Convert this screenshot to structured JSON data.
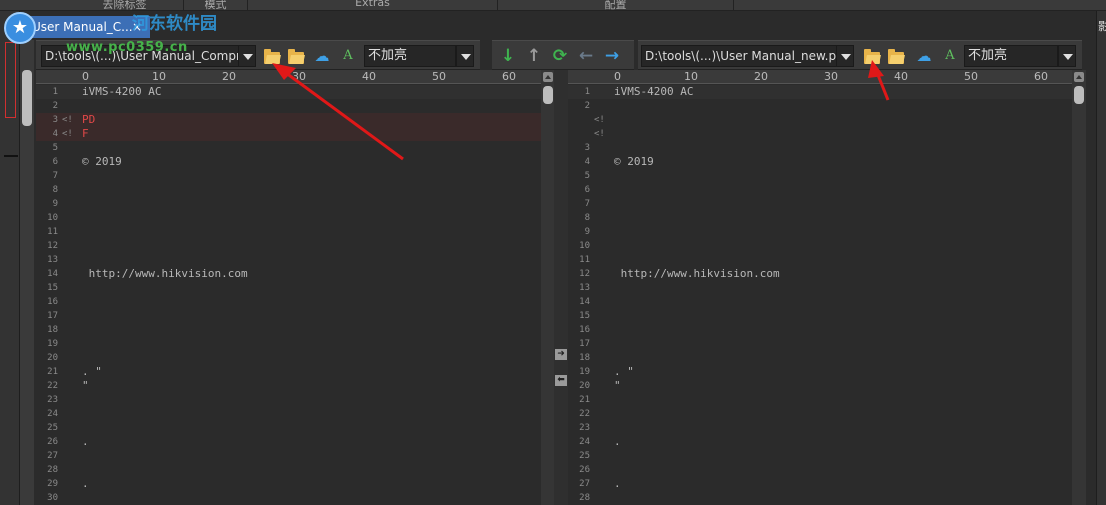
{
  "ribbon": {
    "tabs": [
      "去除标签",
      "模式",
      "Extras",
      "配置"
    ]
  },
  "watermark": {
    "site": "www.pc0359.cn",
    "name": "河东软件园"
  },
  "document_tab": {
    "title": "User Manual_C...",
    "close_glyph": "×"
  },
  "left_toolbar": {
    "path": "D:\\tools\\(...)\\User Manual_Compr",
    "encoding": "不加亮"
  },
  "right_toolbar": {
    "path": "D:\\tools\\(...)\\User Manual_new.pd",
    "encoding": "不加亮"
  },
  "icons": {
    "open_folder": "open-folder-icon",
    "recent_folder": "recent-folder-icon",
    "reload": "reload-icon",
    "cloud": "cloud-icon",
    "font": "A",
    "next_diff": "↓",
    "prev_diff": "↑",
    "sync": "⟳",
    "copy_left": "←",
    "copy_right": "→"
  },
  "ruler": {
    "labels": [
      "0",
      "10",
      "20",
      "30",
      "40",
      "50",
      "60"
    ]
  },
  "left_pane": {
    "lines": [
      {
        "num": "1",
        "mark": "",
        "text": "iVMS-4200 AC",
        "type": "first"
      },
      {
        "num": "2",
        "mark": "",
        "text": "",
        "type": ""
      },
      {
        "num": "3",
        "mark": "<!",
        "text": "PD",
        "type": "removed"
      },
      {
        "num": "4",
        "mark": "<!",
        "text": "F",
        "type": "removed"
      },
      {
        "num": "5",
        "mark": "",
        "text": "",
        "type": ""
      },
      {
        "num": "6",
        "mark": "",
        "text": "© 2019",
        "type": ""
      },
      {
        "num": "7",
        "mark": "",
        "text": "",
        "type": ""
      },
      {
        "num": "8",
        "mark": "",
        "text": "",
        "type": ""
      },
      {
        "num": "9",
        "mark": "",
        "text": "",
        "type": ""
      },
      {
        "num": "10",
        "mark": "",
        "text": "",
        "type": ""
      },
      {
        "num": "11",
        "mark": "",
        "text": "",
        "type": ""
      },
      {
        "num": "12",
        "mark": "",
        "text": "",
        "type": ""
      },
      {
        "num": "13",
        "mark": "",
        "text": "",
        "type": ""
      },
      {
        "num": "14",
        "mark": "",
        "text": " http://www.hikvision.com",
        "type": ""
      },
      {
        "num": "15",
        "mark": "",
        "text": "",
        "type": ""
      },
      {
        "num": "16",
        "mark": "",
        "text": "",
        "type": ""
      },
      {
        "num": "17",
        "mark": "",
        "text": "",
        "type": ""
      },
      {
        "num": "18",
        "mark": "",
        "text": "",
        "type": ""
      },
      {
        "num": "19",
        "mark": "",
        "text": "",
        "type": ""
      },
      {
        "num": "20",
        "mark": "",
        "text": "",
        "type": ""
      },
      {
        "num": "21",
        "mark": "",
        "text": ". \"",
        "type": ""
      },
      {
        "num": "22",
        "mark": "",
        "text": "\"",
        "type": ""
      },
      {
        "num": "23",
        "mark": "",
        "text": "",
        "type": ""
      },
      {
        "num": "24",
        "mark": "",
        "text": "",
        "type": ""
      },
      {
        "num": "25",
        "mark": "",
        "text": "",
        "type": ""
      },
      {
        "num": "26",
        "mark": "",
        "text": ".",
        "type": ""
      },
      {
        "num": "27",
        "mark": "",
        "text": "",
        "type": ""
      },
      {
        "num": "28",
        "mark": "",
        "text": "",
        "type": ""
      },
      {
        "num": "29",
        "mark": "",
        "text": ".",
        "type": ""
      },
      {
        "num": "30",
        "mark": "",
        "text": "",
        "type": ""
      }
    ]
  },
  "right_pane": {
    "lines": [
      {
        "num": "1",
        "mark": "",
        "text": "iVMS-4200 AC",
        "type": "first"
      },
      {
        "num": "2",
        "mark": "",
        "text": "",
        "type": ""
      },
      {
        "num": "",
        "mark": "<!",
        "text": "",
        "type": ""
      },
      {
        "num": "",
        "mark": "<!",
        "text": "",
        "type": ""
      },
      {
        "num": "3",
        "mark": "",
        "text": "",
        "type": ""
      },
      {
        "num": "4",
        "mark": "",
        "text": "© 2019",
        "type": ""
      },
      {
        "num": "5",
        "mark": "",
        "text": "",
        "type": ""
      },
      {
        "num": "6",
        "mark": "",
        "text": "",
        "type": ""
      },
      {
        "num": "7",
        "mark": "",
        "text": "",
        "type": ""
      },
      {
        "num": "8",
        "mark": "",
        "text": "",
        "type": ""
      },
      {
        "num": "9",
        "mark": "",
        "text": "",
        "type": ""
      },
      {
        "num": "10",
        "mark": "",
        "text": "",
        "type": ""
      },
      {
        "num": "11",
        "mark": "",
        "text": "",
        "type": ""
      },
      {
        "num": "12",
        "mark": "",
        "text": " http://www.hikvision.com",
        "type": ""
      },
      {
        "num": "13",
        "mark": "",
        "text": "",
        "type": ""
      },
      {
        "num": "14",
        "mark": "",
        "text": "",
        "type": ""
      },
      {
        "num": "15",
        "mark": "",
        "text": "",
        "type": ""
      },
      {
        "num": "16",
        "mark": "",
        "text": "",
        "type": ""
      },
      {
        "num": "17",
        "mark": "",
        "text": "",
        "type": ""
      },
      {
        "num": "18",
        "mark": "",
        "text": "",
        "type": ""
      },
      {
        "num": "19",
        "mark": "",
        "text": ". \"",
        "type": ""
      },
      {
        "num": "20",
        "mark": "",
        "text": "\"",
        "type": ""
      },
      {
        "num": "21",
        "mark": "",
        "text": "",
        "type": ""
      },
      {
        "num": "22",
        "mark": "",
        "text": "",
        "type": ""
      },
      {
        "num": "23",
        "mark": "",
        "text": "",
        "type": ""
      },
      {
        "num": "24",
        "mark": "",
        "text": ".",
        "type": ""
      },
      {
        "num": "25",
        "mark": "",
        "text": "",
        "type": ""
      },
      {
        "num": "26",
        "mark": "",
        "text": "",
        "type": ""
      },
      {
        "num": "27",
        "mark": "",
        "text": ".",
        "type": ""
      },
      {
        "num": "28",
        "mark": "",
        "text": "",
        "type": ""
      }
    ]
  },
  "right_strip": {
    "label": "影"
  },
  "colors": {
    "tab_active": "#3c6fb6",
    "removed_text": "#e04848",
    "annotation_arrow": "#e01818",
    "folder": "#e8b44a",
    "nav_green": "#3fb34f",
    "nav_blue": "#3ea0e6"
  }
}
